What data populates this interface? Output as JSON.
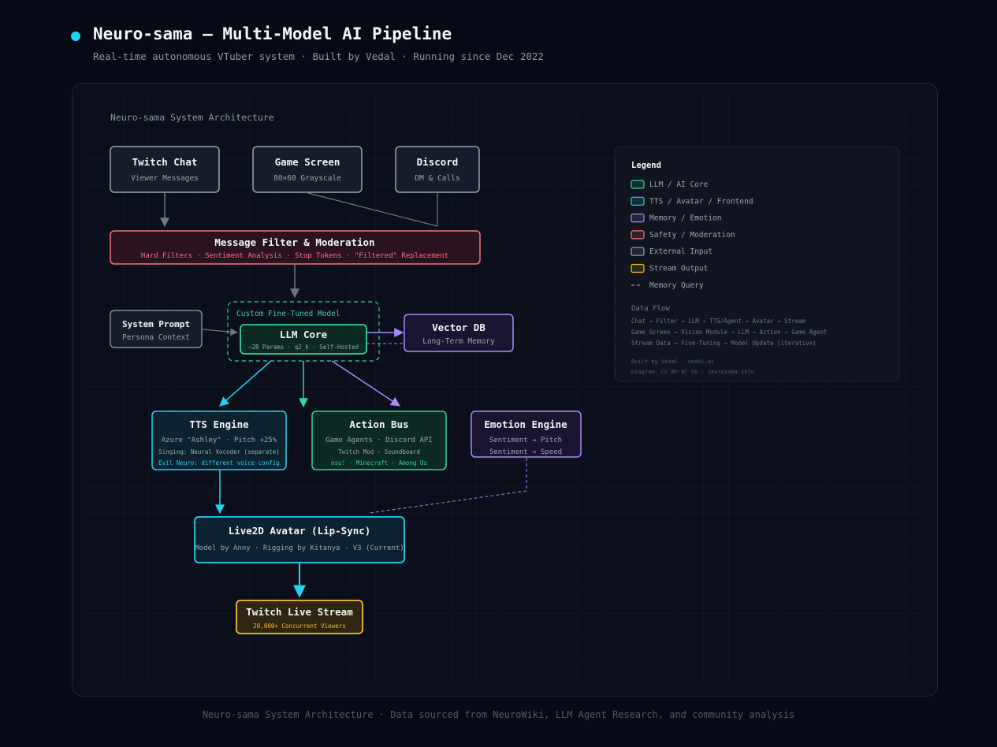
{
  "header": {
    "title": "Neuro-sama — Multi-Model AI Pipeline",
    "subtitle": "Real-time autonomous VTuber system · Built by Vedal · Running since Dec 2022"
  },
  "diagram": {
    "title": "Neuro-sama System Architecture",
    "nodes": {
      "twitch_chat": {
        "title": "Twitch Chat",
        "sub": "Viewer Messages"
      },
      "game_screen": {
        "title": "Game Screen",
        "sub": "80×60 Grayscale"
      },
      "discord": {
        "title": "Discord",
        "sub": "DM & Calls"
      },
      "filter": {
        "title": "Message Filter & Moderation",
        "sub": "Hard Filters · Sentiment Analysis · Stop Tokens · \"Filtered\" Replacement"
      },
      "system_prompt": {
        "title": "System Prompt",
        "sub": "Persona Context"
      },
      "custom_model_label": "Custom Fine-Tuned Model",
      "llm_core": {
        "title": "LLM Core",
        "sub": "~2B Params · q2_k · Self-Hosted"
      },
      "vector_db": {
        "title": "Vector DB",
        "sub": "Long-Term Memory"
      },
      "tts": {
        "title": "TTS Engine",
        "line1": "Azure \"Ashley\" · Pitch +25%",
        "line2": "Singing: Neural Vocoder (separate)",
        "line3": "Evil Neuro: different voice config"
      },
      "action_bus": {
        "title": "Action Bus",
        "line1": "Game Agents · Discord API",
        "line2": "Twitch Mod · Soundboard",
        "line3": "osu! · Minecraft · Among Us"
      },
      "emotion": {
        "title": "Emotion Engine",
        "line1": "Sentiment → Pitch",
        "line2": "Sentiment → Speed"
      },
      "avatar": {
        "title": "Live2D Avatar (Lip-Sync)",
        "sub": "Model by Anny · Rigging by Kitanya · V3 (Current)"
      },
      "stream": {
        "title": "Twitch Live Stream",
        "sub": "20,000+ Concurrent Viewers"
      }
    },
    "legend": {
      "title": "Legend",
      "items": [
        {
          "label": "LLM / AI Core",
          "color": "#34d399"
        },
        {
          "label": "TTS / Avatar / Frontend",
          "color": "#22d3ee"
        },
        {
          "label": "Memory / Emotion",
          "color": "#a78bfa"
        },
        {
          "label": "Safety / Moderation",
          "color": "#fb7185"
        },
        {
          "label": "External Input",
          "color": "#94a3b8"
        },
        {
          "label": "Stream Output",
          "color": "#fbbf24"
        }
      ],
      "memory_query": "Memory Query",
      "flow_title": "Data Flow",
      "flows": [
        "Chat → Filter → LLM → TTS/Agent → Avatar → Stream",
        "Game Screen → Vision Module → LLM → Action → Game Agent",
        "Stream Data → Fine-Tuning → Model Update (iterative)"
      ],
      "credit1": "Built by Vedal · vedal.ai",
      "credit2": "Diagram: CC BY-NC-SA · neurosama.info"
    }
  },
  "footer": "Neuro-sama System Architecture · Data sourced from NeuroWiki, LLM Agent Research, and community analysis"
}
